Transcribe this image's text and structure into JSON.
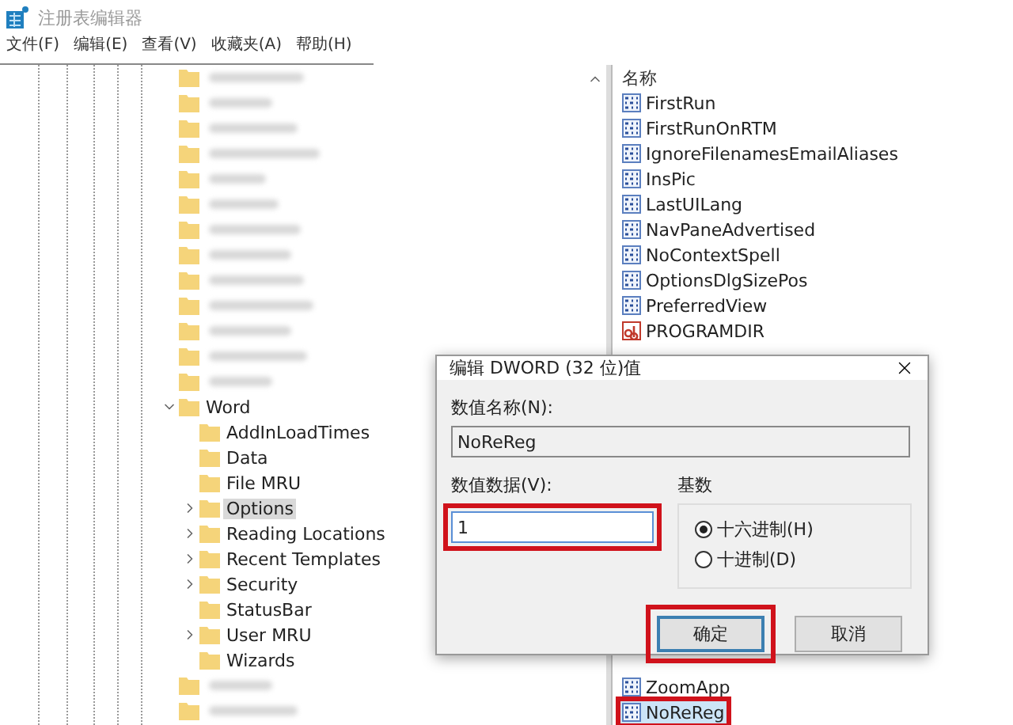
{
  "window": {
    "title": "注册表编辑器"
  },
  "menu": [
    {
      "label": "文件(F)"
    },
    {
      "label": "编辑(E)"
    },
    {
      "label": "查看(V)"
    },
    {
      "label": "收藏夹(A)"
    },
    {
      "label": "帮助(H)"
    }
  ],
  "tree": {
    "items": [
      {
        "kind": "blurred"
      },
      {
        "kind": "blurred"
      },
      {
        "kind": "blurred"
      },
      {
        "kind": "blurred"
      },
      {
        "kind": "blurred"
      },
      {
        "kind": "blurred"
      },
      {
        "kind": "blurred"
      },
      {
        "kind": "blurred"
      },
      {
        "kind": "blurred"
      },
      {
        "kind": "blurred"
      },
      {
        "kind": "blurred"
      },
      {
        "kind": "blurred"
      },
      {
        "kind": "blurred"
      },
      {
        "kind": "key",
        "label": "Word",
        "expanded": true,
        "selected": false,
        "children": [
          {
            "kind": "key",
            "label": "AddInLoadTimes",
            "has_children": false,
            "selected": false
          },
          {
            "kind": "key",
            "label": "Data",
            "has_children": false,
            "selected": false
          },
          {
            "kind": "key",
            "label": "File MRU",
            "has_children": false,
            "selected": false
          },
          {
            "kind": "key",
            "label": "Options",
            "has_children": true,
            "selected": true
          },
          {
            "kind": "key",
            "label": "Reading Locations",
            "has_children": true,
            "selected": false
          },
          {
            "kind": "key",
            "label": "Recent Templates",
            "has_children": true,
            "selected": false
          },
          {
            "kind": "key",
            "label": "Security",
            "has_children": true,
            "selected": false
          },
          {
            "kind": "key",
            "label": "StatusBar",
            "has_children": false,
            "selected": false
          },
          {
            "kind": "key",
            "label": "User MRU",
            "has_children": true,
            "selected": false
          },
          {
            "kind": "key",
            "label": "Wizards",
            "has_children": false,
            "selected": false
          }
        ]
      },
      {
        "kind": "blurred"
      },
      {
        "kind": "blurred"
      }
    ]
  },
  "values": {
    "column": "名称",
    "top": [
      {
        "kind": "dword",
        "name": "FirstRun"
      },
      {
        "kind": "dword",
        "name": "FirstRunOnRTM"
      },
      {
        "kind": "dword",
        "name": "IgnoreFilenamesEmailAliases"
      },
      {
        "kind": "dword",
        "name": "InsPic"
      },
      {
        "kind": "dword",
        "name": "LastUILang"
      },
      {
        "kind": "dword",
        "name": "NavPaneAdvertised"
      },
      {
        "kind": "dword",
        "name": "NoContextSpell"
      },
      {
        "kind": "dword",
        "name": "OptionsDlgSizePos"
      },
      {
        "kind": "dword",
        "name": "PreferredView"
      },
      {
        "kind": "string",
        "name": "PROGRAMDIR"
      }
    ],
    "bottom": [
      {
        "kind": "dword",
        "name": "ZoomApp",
        "selected": false,
        "highlighted": false
      },
      {
        "kind": "dword",
        "name": "NoReReg",
        "selected": true,
        "highlighted": true
      }
    ]
  },
  "dialog": {
    "title": "编辑 DWORD (32 位)值",
    "name_label": "数值名称(N):",
    "name_value": "NoReReg",
    "data_label": "数值数据(V):",
    "data_value": "1",
    "data_highlighted": true,
    "base_label": "基数",
    "bases": [
      {
        "label": "十六进制(H)",
        "selected": true
      },
      {
        "label": "十进制(D)",
        "selected": false
      }
    ],
    "buttons": [
      {
        "label": "确定",
        "default": true,
        "highlighted": true
      },
      {
        "label": "取消",
        "default": false,
        "highlighted": false
      }
    ]
  }
}
